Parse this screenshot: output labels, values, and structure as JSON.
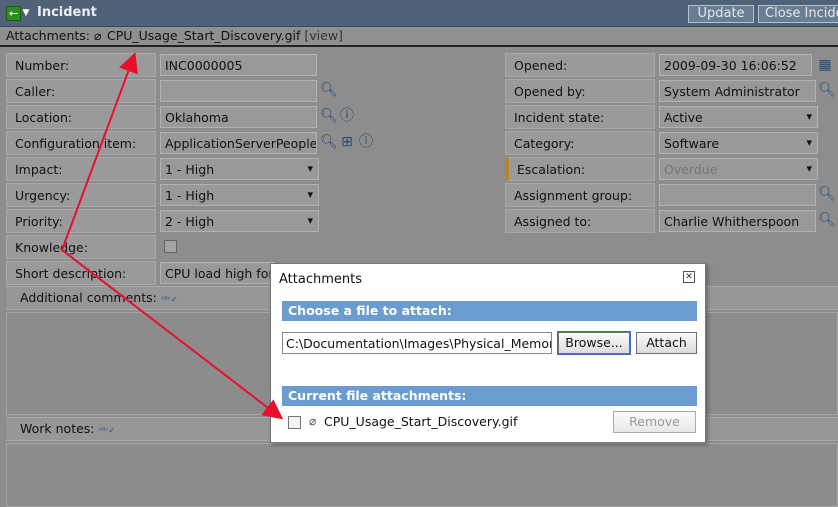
{
  "header": {
    "title": "Incident",
    "update_label": "Update",
    "close_label": "Close Incident"
  },
  "attachments_bar": {
    "label": "Attachments:",
    "file_name": "CPU_Usage_Start_Discovery.gif",
    "view_label": "[view]"
  },
  "form_left": {
    "number": {
      "label": "Number:",
      "value": "INC0000005"
    },
    "caller": {
      "label": "Caller:",
      "value": ""
    },
    "location": {
      "label": "Location:",
      "value": "Oklahoma"
    },
    "config_item": {
      "label": "Configuration item:",
      "value": "ApplicationServerPeopleS"
    },
    "impact": {
      "label": "Impact:",
      "value": "1 - High"
    },
    "urgency": {
      "label": "Urgency:",
      "value": "1 - High"
    },
    "priority": {
      "label": "Priority:",
      "value": "2 - High"
    },
    "knowledge": {
      "label": "Knowledge:"
    },
    "short_desc": {
      "label": "Short description:",
      "value": "CPU load high for d"
    }
  },
  "form_right": {
    "opened": {
      "label": "Opened:",
      "value": "2009-09-30 16:06:52"
    },
    "opened_by": {
      "label": "Opened by:",
      "value": "System Administrator"
    },
    "incident_state": {
      "label": "Incident state:",
      "value": "Active"
    },
    "category": {
      "label": "Category:",
      "value": "Software"
    },
    "escalation": {
      "label": "Escalation:",
      "value": "Overdue"
    },
    "assignment_group": {
      "label": "Assignment group:",
      "value": ""
    },
    "assigned_to": {
      "label": "Assigned to:",
      "value": "Charlie Whitherspoon"
    }
  },
  "sections": {
    "additional_comments": "Additional comments:",
    "work_notes": "Work notes:"
  },
  "dialog": {
    "title": "Attachments",
    "choose_label": "Choose a file to attach:",
    "file_path": "C:\\Documentation\\Images\\Physical_Memory.",
    "browse_label": "Browse...",
    "attach_label": "Attach",
    "current_label": "Current file attachments:",
    "attachment_name": "CPU_Usage_Start_Discovery.gif",
    "remove_label": "Remove"
  },
  "colors": {
    "title_bar": "#4f6278",
    "dialog_bar": "#6b9cd0",
    "arrow": "#e8102a"
  },
  "icons": [
    "back-icon",
    "paperclip-icon",
    "search-icon",
    "calendar-icon",
    "info-icon",
    "tree-icon",
    "spellcheck-icon",
    "close-icon"
  ]
}
